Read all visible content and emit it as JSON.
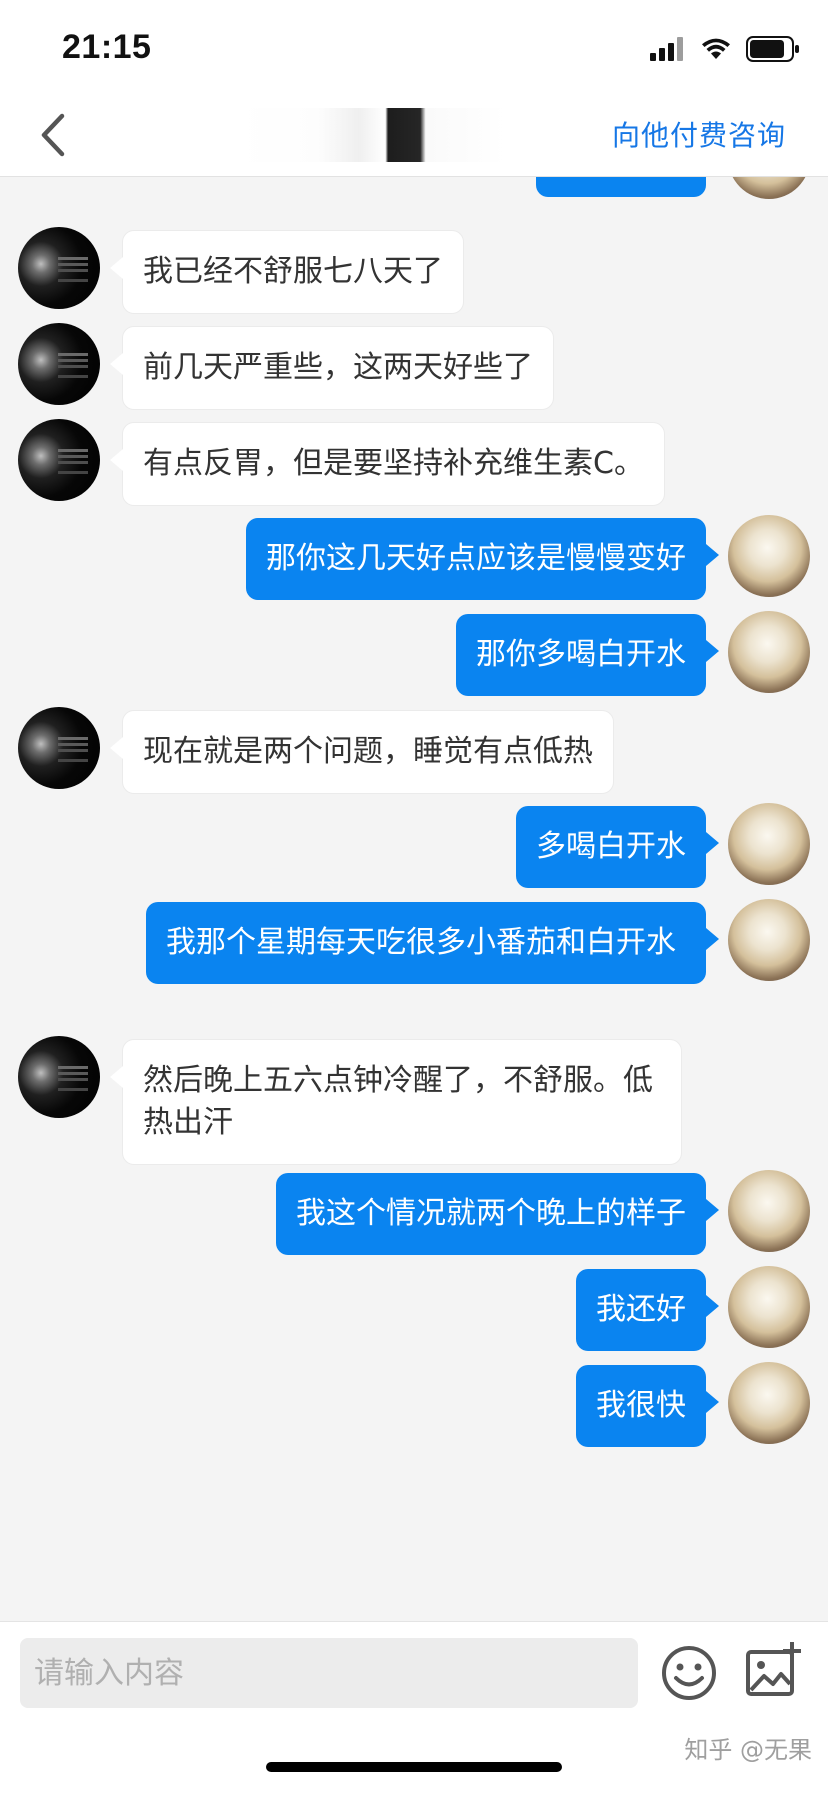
{
  "status_bar": {
    "time": "21:15"
  },
  "nav": {
    "back_icon": "chevron-left-icon",
    "action_label": "向他付费咨询",
    "accent_color": "#1677e6"
  },
  "colors": {
    "my_bubble": "#0a84f0",
    "their_bubble": "#ffffff",
    "background": "#f4f4f4"
  },
  "messages": [
    {
      "side": "left",
      "text": "我已经不舒服七八天了"
    },
    {
      "side": "left",
      "text": "前几天严重些，这两天好些了"
    },
    {
      "side": "left",
      "text": "有点反胃，但是要坚持补充维生素C。"
    },
    {
      "side": "right",
      "text": "那你这几天好点应该是慢慢变好"
    },
    {
      "side": "right",
      "text": "那你多喝白开水"
    },
    {
      "side": "left",
      "text": "现在就是两个问题，睡觉有点低热"
    },
    {
      "side": "right",
      "text": "多喝白开水"
    },
    {
      "side": "right",
      "text": "我那个星期每天吃很多小番茄和白开水"
    },
    {
      "side": "left",
      "text": "然后晚上五六点钟冷醒了，不舒服。低热出汗"
    },
    {
      "side": "right",
      "text": "我这个情况就两个晚上的样子"
    },
    {
      "side": "right",
      "text": "我还好"
    },
    {
      "side": "right",
      "text": "我很快"
    }
  ],
  "input": {
    "placeholder": "请输入内容",
    "value": ""
  },
  "watermark": "知乎 @无果"
}
